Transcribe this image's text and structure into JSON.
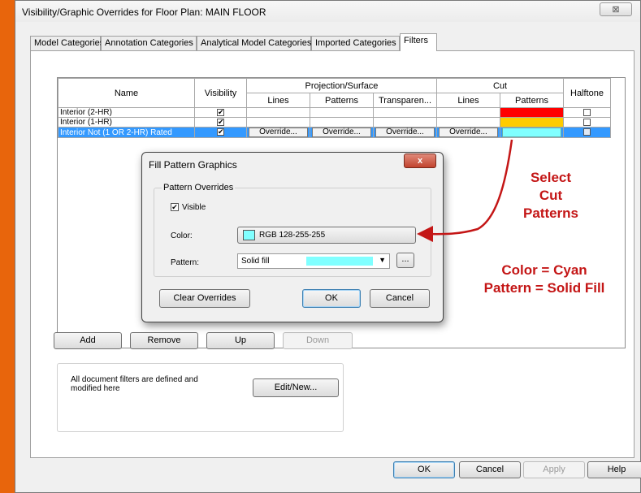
{
  "window": {
    "title": "Visibility/Graphic Overrides for Floor Plan: MAIN FLOOR",
    "close_glyph": "⊠"
  },
  "tabs": [
    {
      "label": "Model Categories"
    },
    {
      "label": "Annotation Categories"
    },
    {
      "label": "Analytical Model Categories"
    },
    {
      "label": "Imported Categories"
    },
    {
      "label": "Filters"
    }
  ],
  "active_tab": "Filters",
  "grid": {
    "headers": {
      "name": "Name",
      "visibility": "Visibility",
      "projection": "Projection/Surface",
      "cut": "Cut",
      "halftone": "Halftone",
      "lines": "Lines",
      "patterns": "Patterns",
      "transparency": "Transparen...",
      "cut_lines": "Lines",
      "cut_patterns": "Patterns"
    },
    "rows": [
      {
        "name": "Interior (2-HR)",
        "visible": true,
        "cut_pattern_color": "#ff0000",
        "halftone": false
      },
      {
        "name": "Interior (1-HR)",
        "visible": true,
        "cut_pattern_color": "#ffcc00",
        "halftone": false
      },
      {
        "name": "Interior Not (1 OR 2-HR) Rated",
        "visible": true,
        "cut_pattern_color": "#80ffff",
        "halftone": false,
        "selected": true
      }
    ],
    "override_label": "Override..."
  },
  "buttons": {
    "add": "Add",
    "remove": "Remove",
    "up": "Up",
    "down": "Down",
    "edit_new": "Edit/New...",
    "ok": "OK",
    "cancel": "Cancel",
    "apply": "Apply",
    "help": "Help"
  },
  "info": {
    "text": "All document filters are defined and modified here"
  },
  "fill_dialog": {
    "title": "Fill Pattern Graphics",
    "close_glyph": "x",
    "group_label": "Pattern Overrides",
    "visible_label": "Visible",
    "visible_checked": true,
    "color_label": "Color:",
    "color_value": "RGB 128-255-255",
    "color_hex": "#80ffff",
    "pattern_label": "Pattern:",
    "pattern_value": "Solid fill",
    "browse_label": "...",
    "clear_overrides": "Clear Overrides",
    "ok": "OK",
    "cancel": "Cancel"
  },
  "annotations": {
    "select_line1": "Select",
    "select_line2": "Cut",
    "select_line3": "Patterns",
    "color_note": "Color = Cyan",
    "pattern_note": "Pattern = Solid Fill",
    "color": "#c41616"
  }
}
